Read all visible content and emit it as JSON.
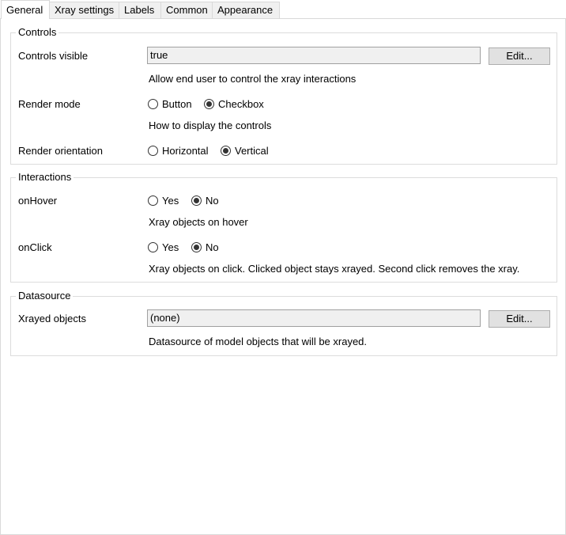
{
  "tabs": [
    {
      "label": "General",
      "active": true
    },
    {
      "label": "Xray settings",
      "active": false
    },
    {
      "label": "Labels",
      "active": false
    },
    {
      "label": "Common",
      "active": false
    },
    {
      "label": "Appearance",
      "active": false
    }
  ],
  "controls": {
    "title": "Controls",
    "visible_label": "Controls visible",
    "visible_value": "true",
    "edit_label": "Edit...",
    "visible_hint": "Allow end user to control the xray interactions",
    "render_mode_label": "Render mode",
    "render_mode_options": [
      {
        "label": "Button",
        "checked": false
      },
      {
        "label": "Checkbox",
        "checked": true
      }
    ],
    "render_mode_hint": "How to display the controls",
    "orientation_label": "Render orientation",
    "orientation_options": [
      {
        "label": "Horizontal",
        "checked": false
      },
      {
        "label": "Vertical",
        "checked": true
      }
    ]
  },
  "interactions": {
    "title": "Interactions",
    "hover_label": "onHover",
    "hover_options": [
      {
        "label": "Yes",
        "checked": false
      },
      {
        "label": "No",
        "checked": true
      }
    ],
    "hover_hint": "Xray objects on hover",
    "click_label": "onClick",
    "click_options": [
      {
        "label": "Yes",
        "checked": false
      },
      {
        "label": "No",
        "checked": true
      }
    ],
    "click_hint": "Xray objects on click. Clicked object stays xrayed. Second click removes the xray."
  },
  "datasource": {
    "title": "Datasource",
    "objects_label": "Xrayed objects",
    "objects_value": "(none)",
    "edit_label": "Edit...",
    "objects_hint": "Datasource of model objects that will be xrayed."
  }
}
